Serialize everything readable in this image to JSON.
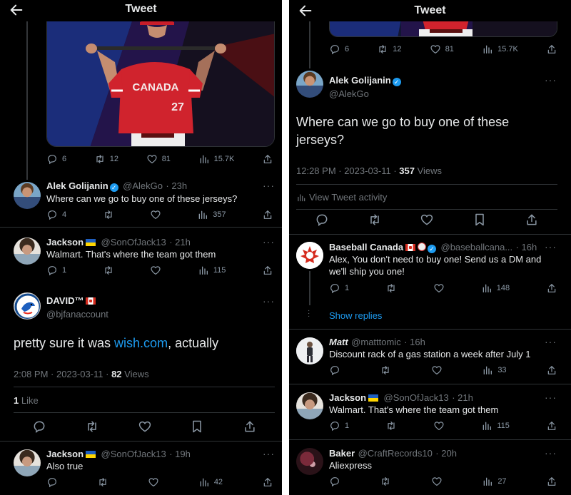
{
  "left": {
    "title": "Tweet",
    "photo_stats": {
      "replies": "6",
      "retweets": "12",
      "likes": "81",
      "views": "15.7K"
    },
    "reply1": {
      "name": "Alek Golijanin",
      "handle": "@AlekGo",
      "time": "· 23h",
      "text": "Where can we go to buy one of these jerseys?",
      "replies": "4",
      "views": "357"
    },
    "reply2": {
      "name": "Jackson",
      "handle": "@SonOfJack13",
      "time": "· 21h",
      "text": "Walmart. That's where the team got them",
      "replies": "1",
      "views": "115"
    },
    "main": {
      "name": "DAVID™",
      "handle": "@bjfanaccount",
      "text_pre": "pretty sure it was ",
      "text_link": "wish.com",
      "text_post": ", actually",
      "time": "2:08 PM · 2023-03-11 · ",
      "views_count": "82",
      "views_label": " Views",
      "likes_count": "1",
      "likes_label": " Like"
    },
    "reply3": {
      "name": "Jackson",
      "handle": "@SonOfJack13",
      "time": "· 19h",
      "text": "Also true",
      "views": "42"
    }
  },
  "right": {
    "title": "Tweet",
    "photo_stats": {
      "replies": "6",
      "retweets": "12",
      "likes": "81",
      "views": "15.7K"
    },
    "main": {
      "name": "Alek Golijanin",
      "handle": "@AlekGo",
      "text": "Where can we go to buy one of these jerseys?",
      "time": "12:28 PM · 2023-03-11 · ",
      "views_count": "357",
      "views_label": " Views",
      "activity": "View Tweet activity"
    },
    "reply1": {
      "name": "Baseball Canada",
      "handle": "@baseballcana...",
      "time": "· 16h",
      "text": "Alex, You don't need to buy one! Send us a DM and we'll ship you one!",
      "replies": "1",
      "views": "148",
      "show_replies": "Show replies"
    },
    "reply2": {
      "name": "Matt",
      "handle": "@matttomic",
      "time": "· 16h",
      "text": "Discount rack of a gas station a week after July 1",
      "views": "33"
    },
    "reply3": {
      "name": "Jackson",
      "handle": "@SonOfJack13",
      "time": "· 21h",
      "text": "Walmart. That's where the team got them",
      "replies": "1",
      "views": "115"
    },
    "reply4": {
      "name": "Baker",
      "handle": "@CraftRecords10",
      "time": "· 20h",
      "text": "Aliexpress",
      "views": "27"
    }
  },
  "photo": {
    "jersey_text": "CANADA",
    "number": "27"
  },
  "colors": {
    "accent": "#1d9bf0",
    "muted": "#71767b",
    "divider": "#2f3336"
  }
}
